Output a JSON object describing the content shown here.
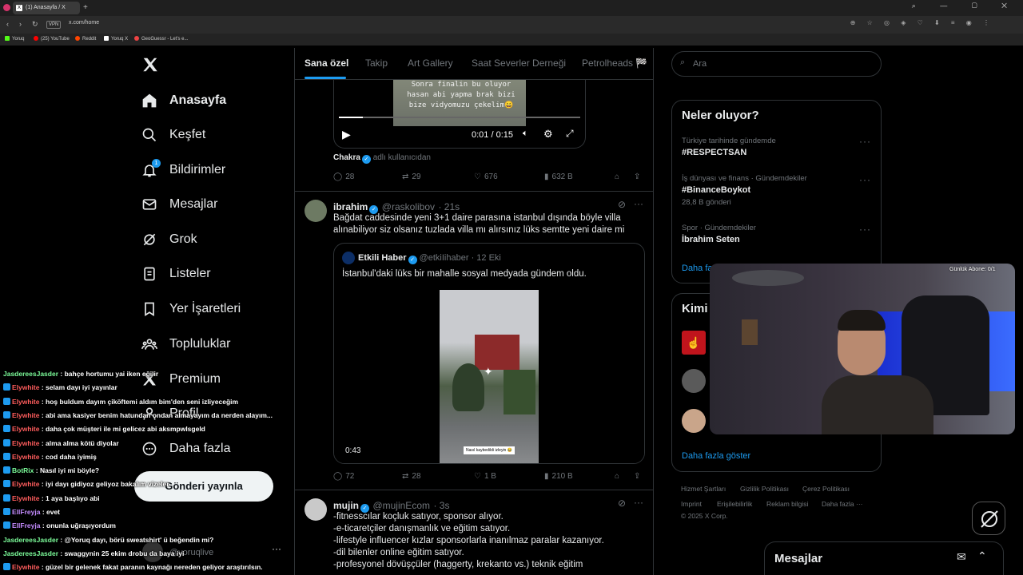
{
  "browser": {
    "tab_title": "(1) Anasayfa / X",
    "url": "x.com/home",
    "vpn_label": "VPN",
    "bookmarks": [
      "Yoruq",
      "(25) YouTube",
      "Reddit",
      "Yoruq X",
      "GeoGuessr - Let's e..."
    ]
  },
  "nav": {
    "items": [
      {
        "label": "Anasayfa",
        "icon": "home-icon"
      },
      {
        "label": "Keşfet",
        "icon": "search-icon"
      },
      {
        "label": "Bildirimler",
        "icon": "bell-icon",
        "badge": "1"
      },
      {
        "label": "Mesajlar",
        "icon": "mail-icon"
      },
      {
        "label": "Grok",
        "icon": "grok-icon"
      },
      {
        "label": "Listeler",
        "icon": "list-icon"
      },
      {
        "label": "Yer İşaretleri",
        "icon": "bookmark-icon"
      },
      {
        "label": "Topluluklar",
        "icon": "communities-icon"
      },
      {
        "label": "Premium",
        "icon": "x-icon"
      },
      {
        "label": "Profil",
        "icon": "profile-icon"
      },
      {
        "label": "Daha fazla",
        "icon": "more-circle-icon"
      }
    ],
    "post_button": "Gönderi yayınla",
    "account_handle": "@yoruqlive"
  },
  "feed": {
    "tabs": [
      "Sana özel",
      "Takip",
      "Art Gallery",
      "Saat Severler Derneği",
      "Petrolheads 🏁"
    ],
    "tweet0": {
      "video_caption": "Sonra finalin bu oluyor hasan abi yapma brak bizi bize vidyomuzu çekelim😄",
      "video_time": "0:01 / 0:15",
      "source_name": "Chakra",
      "source_suffix": "adlı kullanıcıdan",
      "replies": "28",
      "reposts": "29",
      "likes": "676",
      "views": "632 B"
    },
    "tweet1": {
      "name": "ibrahim",
      "handle": "@raskolibov",
      "time": "· 21s",
      "text_line1": "Bağdat caddesinde yeni 3+1 daire parasına istanbul dışında böyle villa",
      "text_line2": "alınabiliyor siz olsanız tuzlada villa mı alırsınız lüks semtte yeni daire mi",
      "quote_name": "Etkili Haber",
      "quote_handle": "@etkiIihaber",
      "quote_time": "· 12 Eki",
      "quote_text": "İstanbul'daki lüks bir mahalle sosyal medyada gündem oldu.",
      "video_duration": "0:43",
      "video_overlay_text": "Nasıl kaybedildi izleyin 😂",
      "replies": "72",
      "reposts": "28",
      "likes": "1 B",
      "views": "210 B"
    },
    "tweet2": {
      "name": "mujin",
      "handle": "@mujinEcom",
      "time": "· 3s",
      "lines": [
        "-fitnesscılar koçluk satıyor, sponsor alıyor.",
        "-e-ticaretçiler danışmanlık ve eğitim satıyor.",
        "-lifestyle influencer kızlar sponsorlarla inanılmaz paralar kazanıyor.",
        "-dil bilenler online eğitim satıyor.",
        "-profesyonel dövüşçüler (haggerty, krekanto vs.) teknik eğitim"
      ]
    }
  },
  "sidebar": {
    "search_placeholder": "Ara",
    "trends_title": "Neler oluyor?",
    "trends": [
      {
        "context": "Türkiye tarihinde gündemde",
        "name": "#RESPECTSAN",
        "meta": ""
      },
      {
        "context": "İş dünyası ve finans · Gündemdekiler",
        "name": "#BinanceBoykot",
        "meta": "28,8 B gönderi"
      },
      {
        "context": "Spor · Gündemdekiler",
        "name": "İbrahim Seten",
        "meta": ""
      }
    ],
    "trends_more": "Daha fa",
    "who_title": "Kimi",
    "who_more": "Daha fazla göster",
    "footer_links": [
      "Hizmet Şartları",
      "Gizlilik Politikası",
      "Çerez Politikası",
      "Imprint",
      "Erişilebilirlik",
      "Reklam bilgisi",
      "Daha fazla ···"
    ],
    "copyright": "© 2025 X Corp.",
    "messages_title": "Mesajlar"
  },
  "stream": {
    "sub_goal": "Günlük Abone: 0/1",
    "chat": [
      {
        "user": "JasdereesJasder",
        "color": "#7cfc9a",
        "badge": false,
        "msg": ": bahçe hortumu yai iken eğilir"
      },
      {
        "user": "Elywhite",
        "color": "#ff5d5d",
        "badge": true,
        "msg": ": selam dayı iyi yayınlar"
      },
      {
        "user": "Elywhite",
        "color": "#ff5d5d",
        "badge": true,
        "msg": ": hoş buldum dayım çiköftemi aldım bim'den seni izliyeceğim"
      },
      {
        "user": "Elywhite",
        "color": "#ff5d5d",
        "badge": true,
        "msg": ": abi ama kasiyer benim hatundan ondan almayayım da nerden alayım..."
      },
      {
        "user": "Elywhite",
        "color": "#ff5d5d",
        "badge": true,
        "msg": ": daha çok müşteri ile mi gelicez abi aksmpwlsgeld"
      },
      {
        "user": "Elywhite",
        "color": "#ff5d5d",
        "badge": true,
        "msg": ": alma alma kötü diyolar"
      },
      {
        "user": "Elywhite",
        "color": "#ff5d5d",
        "badge": true,
        "msg": ": cod daha iyimiş"
      },
      {
        "user": "BotRix",
        "color": "#7cfc9a",
        "badge": true,
        "msg": ": Nasıl iyi mi böyle?"
      },
      {
        "user": "Elywhite",
        "color": "#ff5d5d",
        "badge": true,
        "msg": ": iyi dayı gidiyoz geliyoz bakalım vizeler"
      },
      {
        "user": "Elywhite",
        "color": "#ff5d5d",
        "badge": true,
        "msg": ": 1 aya başlıyo abi"
      },
      {
        "user": "EllFreyja",
        "color": "#c58cff",
        "badge": true,
        "msg": ": evet"
      },
      {
        "user": "EllFreyja",
        "color": "#c58cff",
        "badge": true,
        "msg": ": onunla uğraşıyordum"
      },
      {
        "user": "JasdereesJasder",
        "color": "#7cfc9a",
        "badge": false,
        "msg": ": @Yoruq dayı, börü sweatshirt' ü beğendin mi?"
      },
      {
        "user": "JasdereesJasder",
        "color": "#7cfc9a",
        "badge": false,
        "msg": ": swaggynin 25 ekim drobu da baya iyi"
      },
      {
        "user": "Elywhite",
        "color": "#ff5d5d",
        "badge": true,
        "msg": ": güzel bir gelenek fakat paranın kaynağı nereden geliyor araştırılsın."
      }
    ]
  }
}
